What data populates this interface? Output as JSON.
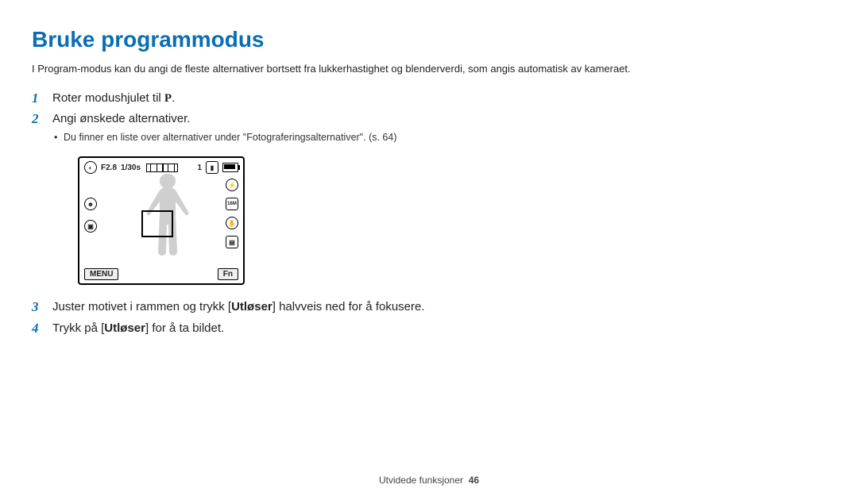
{
  "title": "Bruke programmodus",
  "intro": "I Program-modus kan du angi de fleste alternativer bortsett fra lukkerhastighet og blenderverdi, som angis automatisk av kameraet.",
  "steps": {
    "s1": {
      "num": "1",
      "pre": "Roter modushjulet til ",
      "symbol": "P",
      "post": "."
    },
    "s2": {
      "num": "2",
      "text": "Angi ønskede alternativer.",
      "bullet": "Du finner en liste over alternativer under \"Fotograferingsalternativer\". (s. 64)"
    },
    "s3": {
      "num": "3",
      "pre": "Juster motivet i rammen og trykk [",
      "bold": "Utløser",
      "post": "] halvveis ned for å fokusere."
    },
    "s4": {
      "num": "4",
      "pre": "Trykk på [",
      "bold": "Utløser",
      "post": "] for å ta bildet."
    }
  },
  "camera": {
    "aperture": "F2.8",
    "shutter": "1/30s",
    "count": "1",
    "menu": "MENU",
    "fn": "Fn"
  },
  "footer": {
    "section": "Utvidede funksjoner",
    "page": "46"
  }
}
